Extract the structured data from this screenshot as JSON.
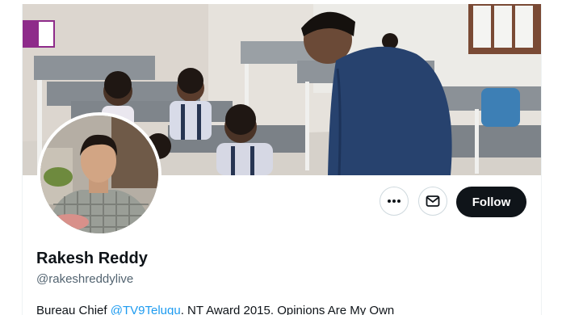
{
  "profile": {
    "name": "Rakesh Reddy",
    "handle": "@rakeshreddylive",
    "bio": {
      "prefix": "Bureau Chief ",
      "mention": "@TV9Telugu",
      "suffix": ". NT Award 2015. Opinions Are My Own"
    }
  },
  "actions": {
    "follow_label": "Follow",
    "more_icon": "more-horizontal-icon",
    "message_icon": "envelope-icon"
  },
  "colors": {
    "follow_bg": "#0f1419",
    "link": "#1d9bf0",
    "handle": "#536471",
    "brand_flag": "#8e2b8a"
  }
}
